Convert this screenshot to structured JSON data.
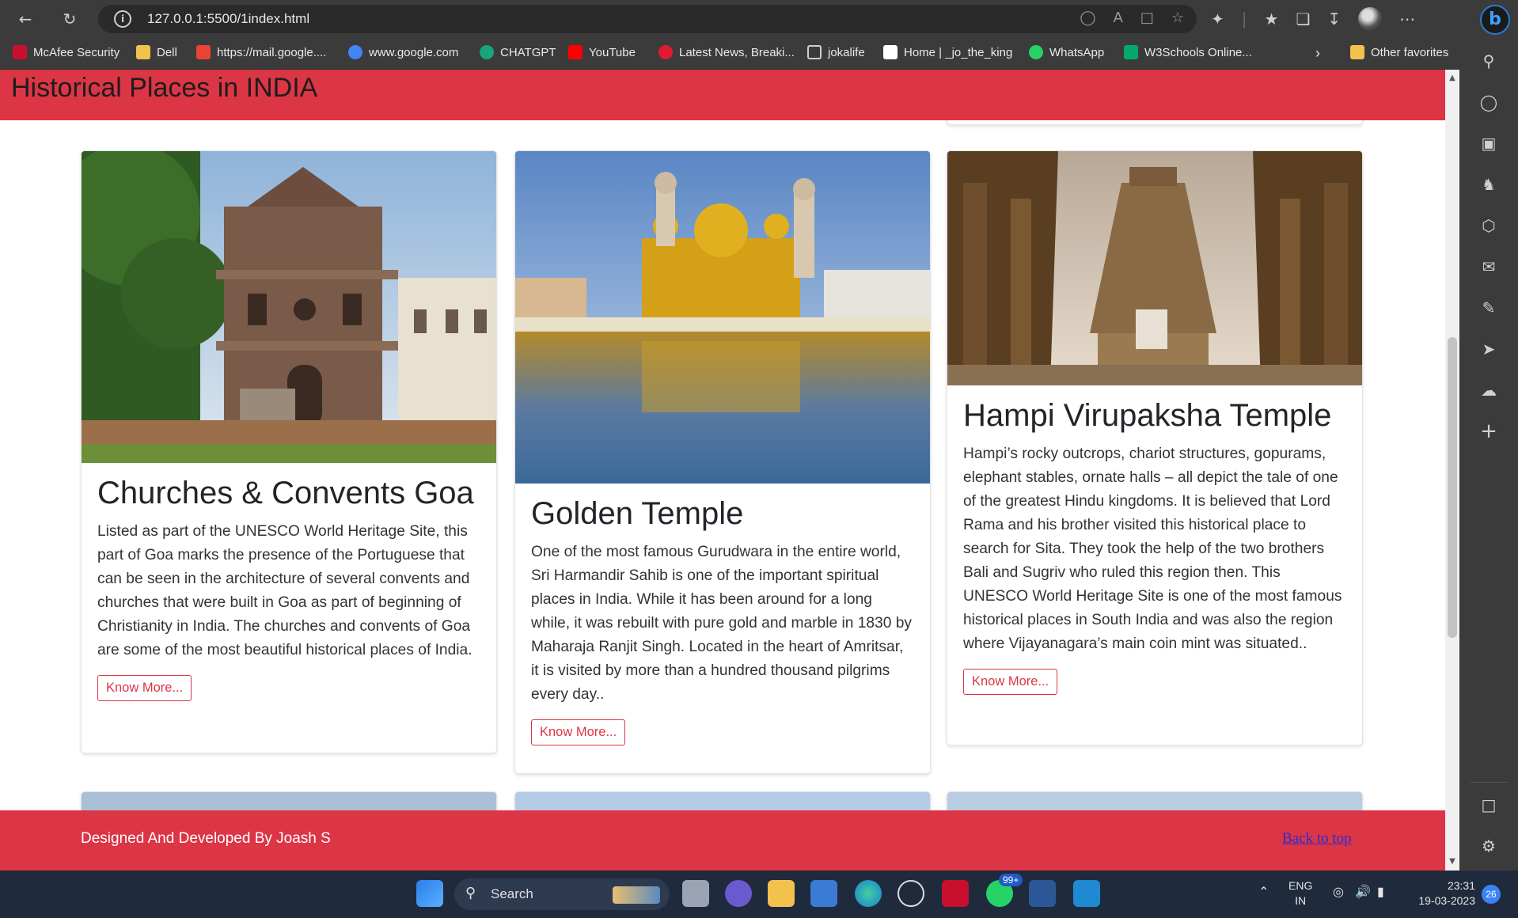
{
  "browser": {
    "url": "127.0.0.1:5500/1index.html",
    "favorites": [
      {
        "label": "McAfee Security",
        "icon": "mcafee-icon",
        "color": "#c8102e"
      },
      {
        "label": "Dell",
        "icon": "folder-icon",
        "color": "#f2c14e"
      },
      {
        "label": "https://mail.google....",
        "icon": "gmail-icon",
        "color": "#ea4335"
      },
      {
        "label": "www.google.com",
        "icon": "google-icon",
        "color": "#4285f4"
      },
      {
        "label": "CHATGPT",
        "icon": "chatgpt-icon",
        "color": "#19a37f"
      },
      {
        "label": "YouTube",
        "icon": "youtube-icon",
        "color": "#ff0000"
      },
      {
        "label": "Latest News, Breaki...",
        "icon": "news-icon",
        "color": "#e01b2f"
      },
      {
        "label": "jokalife",
        "icon": "page-icon",
        "color": "#cfcfcf"
      },
      {
        "label": "Home | _jo_the_king",
        "icon": "wix-icon",
        "color": "#ffffff"
      },
      {
        "label": "WhatsApp",
        "icon": "whatsapp-icon",
        "color": "#25d366"
      },
      {
        "label": "W3Schools Online...",
        "icon": "w3schools-icon",
        "color": "#04aa6d"
      }
    ],
    "other_favorites": "Other favorites"
  },
  "site": {
    "title": "Historical Places in INDIA",
    "accent": "#dc3545"
  },
  "cards": [
    {
      "title": "Churches & Convents Goa",
      "text": "Listed as part of the UNESCO World Heritage Site, this part of Goa marks the presence of the Portuguese that can be seen in the architecture of several convents and churches that were built in Goa as part of beginning of Christianity in India. The churches and convents of Goa are some of the most beautiful historical places of India.",
      "button": "Know More..."
    },
    {
      "title": "Golden Temple",
      "text": "One of the most famous Gurudwara in the entire world, Sri Harmandir Sahib is one of the important spiritual places in India. While it has been around for a long while, it was rebuilt with pure gold and marble in 1830 by Maharaja Ranjit Singh. Located in the heart of Amritsar, it is visited by more than a hundred thousand pilgrims every day..",
      "button": "Know More..."
    },
    {
      "title": "Hampi Virupaksha Temple",
      "text": "Hampi’s rocky outcrops, chariot structures, gopurams, elephant stables, ornate halls – all depict the tale of one of the greatest Hindu kingdoms. It is believed that Lord Rama and his brother visited this historical place to search for Sita. They took the help of the two brothers Bali and Sugriv who ruled this region then. This UNESCO World Heritage Site is one of the most famous historical places in South India and was also the region where Vijayanagara’s main coin mint was situated..",
      "button": "Know More..."
    }
  ],
  "footer": {
    "credit": "Designed And Developed By Joash S",
    "back_to_top": "Back to top"
  },
  "taskbar": {
    "search": "Search",
    "whatsapp_badge": "99+",
    "lang_top": "ENG",
    "lang_bottom": "IN",
    "time": "23:31",
    "date": "19-03-2023",
    "notifications": "26"
  }
}
